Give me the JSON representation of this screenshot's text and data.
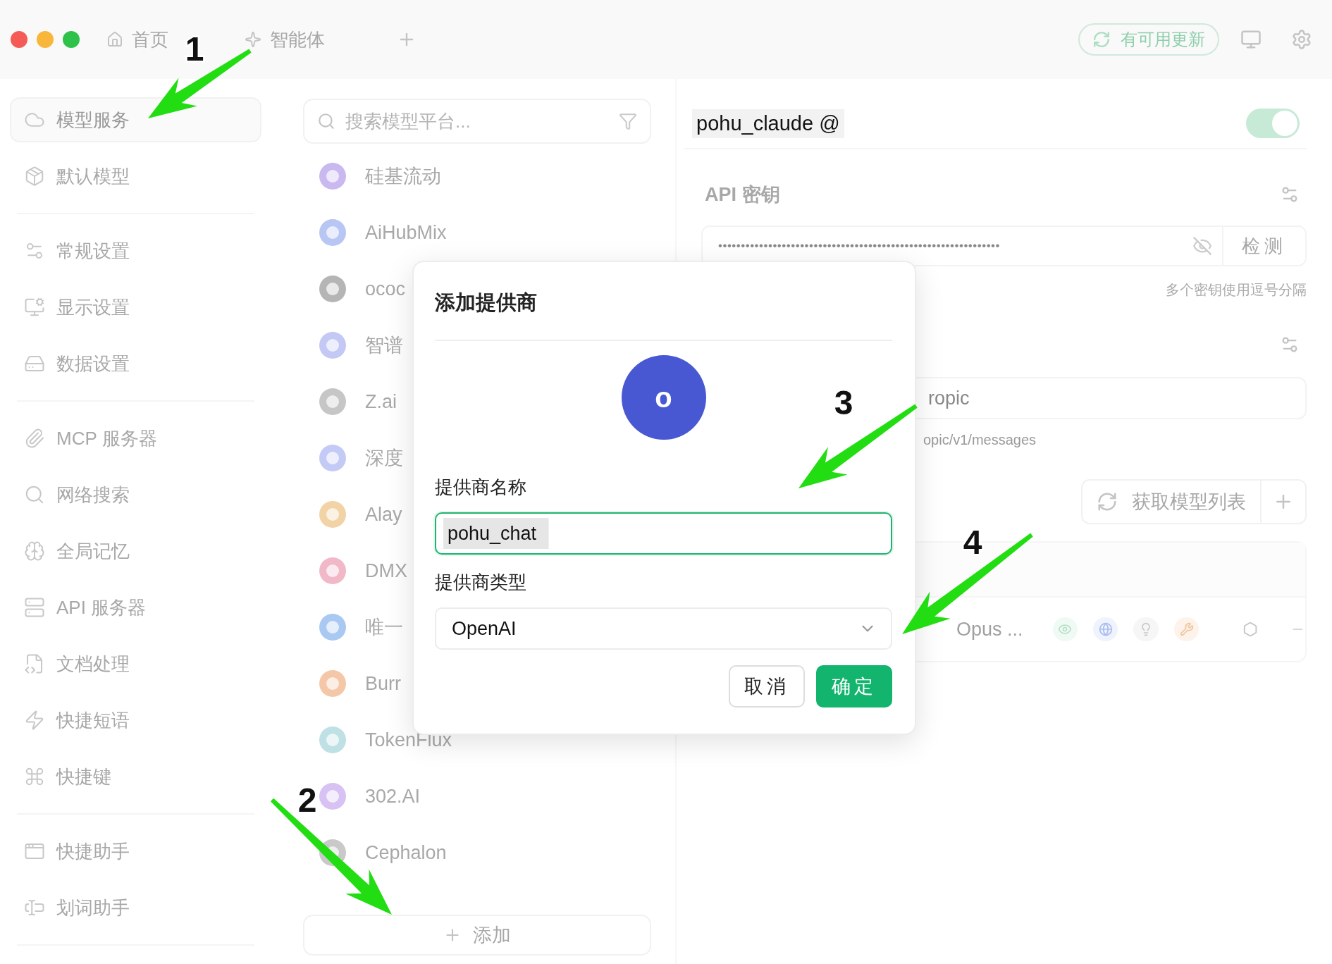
{
  "tabs": [
    {
      "label": "首页",
      "selected": false
    },
    {
      "label": "智能体",
      "selected": false
    }
  ],
  "update_button": {
    "label": "有可用更新"
  },
  "sidebar": {
    "groups": [
      [
        {
          "label": "模型服务",
          "selected": true
        },
        {
          "label": "默认模型",
          "selected": false
        }
      ],
      [
        {
          "label": "常规设置",
          "selected": false
        },
        {
          "label": "显示设置",
          "selected": false
        },
        {
          "label": "数据设置",
          "selected": false
        }
      ],
      [
        {
          "label": "MCP 服务器",
          "selected": false
        },
        {
          "label": "网络搜索",
          "selected": false
        },
        {
          "label": "全局记忆",
          "selected": false
        },
        {
          "label": "API 服务器",
          "selected": false
        },
        {
          "label": "文档处理",
          "selected": false
        },
        {
          "label": "快捷短语",
          "selected": false
        },
        {
          "label": "快捷键",
          "selected": false
        }
      ],
      [
        {
          "label": "快捷助手",
          "selected": false
        },
        {
          "label": "划词助手",
          "selected": false
        }
      ]
    ]
  },
  "providers": {
    "search": {
      "placeholder": "搜索模型平台..."
    },
    "items": [
      {
        "name": "硅基流动"
      },
      {
        "name": "AiHubMix"
      },
      {
        "name": "ococ"
      },
      {
        "name": "智谱"
      },
      {
        "name": "Z.ai"
      },
      {
        "name": "深度"
      },
      {
        "name": "Alay"
      },
      {
        "name": "DMX"
      },
      {
        "name": "唯一"
      },
      {
        "name": "Burr"
      },
      {
        "name": "TokenFlux"
      },
      {
        "name": "302.AI"
      },
      {
        "name": "Cephalon"
      }
    ],
    "add_button": {
      "label": "添加"
    }
  },
  "provider_detail": {
    "name": "pohu_claude @",
    "enabled": true,
    "api_key": {
      "title": "API 密钥",
      "value": "••••••••••••••••••••••••••••••••••••••••••••••••••••••••••••••",
      "check_button": "检测",
      "hint": "多个密钥使用逗号分隔"
    },
    "api_host": {
      "value": "ropic",
      "hint": "opic/v1/messages"
    },
    "fetch_models_button": "获取模型列表",
    "models": [
      {
        "name": "Opus ..."
      }
    ]
  },
  "dialog": {
    "title": "添加提供商",
    "avatar_letter": "o",
    "fields": [
      {
        "label": "提供商名称",
        "value": "pohu_chat",
        "kind": "text",
        "focused": true
      },
      {
        "label": "提供商类型",
        "value": "OpenAI",
        "kind": "select",
        "focused": false
      }
    ],
    "buttons": [
      {
        "label": "取消",
        "primary": false
      },
      {
        "label": "确定",
        "primary": true
      }
    ]
  },
  "annotations": [
    {
      "number": "1"
    },
    {
      "number": "2"
    },
    {
      "number": "3"
    },
    {
      "number": "4"
    }
  ]
}
